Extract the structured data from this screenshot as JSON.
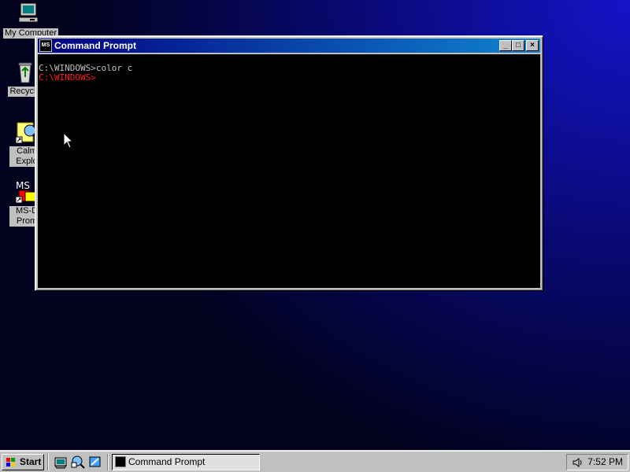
{
  "desktop": {
    "icons": [
      {
        "label": "My Computer",
        "icon": "my-computer-icon"
      },
      {
        "label": "Recycle",
        "icon": "recycle-bin-icon"
      },
      {
        "label": "Calm Explo",
        "icon": "calm-explorer-icon"
      },
      {
        "label": "MS-D Prom",
        "icon": "msdos-prompt-icon"
      }
    ]
  },
  "window": {
    "title": "Command Prompt",
    "minimize_label": "_",
    "maximize_label": "□",
    "close_label": "×",
    "console_lines": [
      {
        "text": "C:\\WINDOWS>color c",
        "color": "#c0c0c0"
      },
      {
        "text": "C:\\WINDOWS>",
        "color": "#ff1a1a"
      }
    ],
    "app_icon_text": "MS"
  },
  "taskbar": {
    "start_label": "Start",
    "quick_launch": [
      "desktop-icon",
      "internet-explorer-icon",
      "channels-icon"
    ],
    "task_label": "Command Prompt",
    "clock": "7:52 PM"
  }
}
